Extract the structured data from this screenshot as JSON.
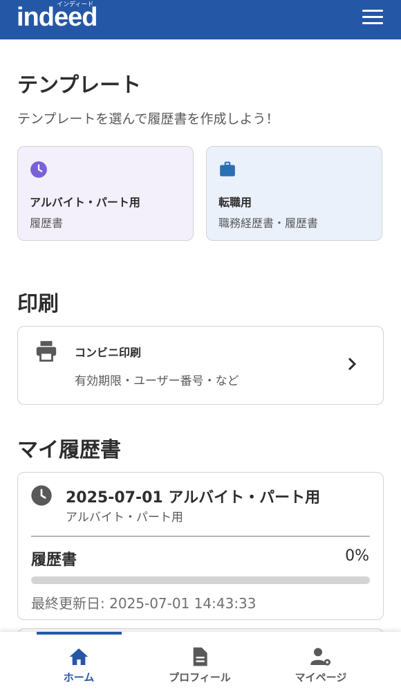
{
  "header": {
    "logo_text": "indeed",
    "logo_kana": "インディード",
    "menu_icon": "hamburger-menu-icon",
    "brand_color": "#2557a7"
  },
  "templates": {
    "heading": "テンプレート",
    "description": "テンプレートを選んで履歴書を作成しよう！",
    "cards": [
      {
        "icon": "clock-icon",
        "title": "アルバイト・パート用",
        "subtitle": "履歴書",
        "icon_color": "#7b61d9",
        "bg_color": "#f3f0fc"
      },
      {
        "icon": "briefcase-icon",
        "title": "転職用",
        "subtitle": "職務経歴書・履歴書",
        "icon_color": "#2a6fb6",
        "bg_color": "#eaf1fb"
      }
    ]
  },
  "print": {
    "heading": "印刷",
    "item": {
      "icon": "printer-icon",
      "title": "コンビニ印刷",
      "subtitle": "有効期限・ユーザー番号・など",
      "chevron": "chevron-right-icon"
    }
  },
  "my_resumes": {
    "heading": "マイ履歴書",
    "items": [
      {
        "icon": "clock-icon",
        "title": "2025-07-01 アルバイト・パート用",
        "subtitle": "アルバイト・パート用",
        "doc_label": "履歴書",
        "progress_text": "0%",
        "progress": 0,
        "updated": "最終更新日: 2025-07-01 14:43:33"
      }
    ]
  },
  "bottom_nav": {
    "items": [
      {
        "label": "ホーム",
        "icon": "home-icon",
        "active": true
      },
      {
        "label": "プロフィール",
        "icon": "document-icon",
        "active": false
      },
      {
        "label": "マイページ",
        "icon": "user-settings-icon",
        "active": false
      }
    ],
    "active_color": "#2557a7",
    "inactive_color": "#595959"
  }
}
